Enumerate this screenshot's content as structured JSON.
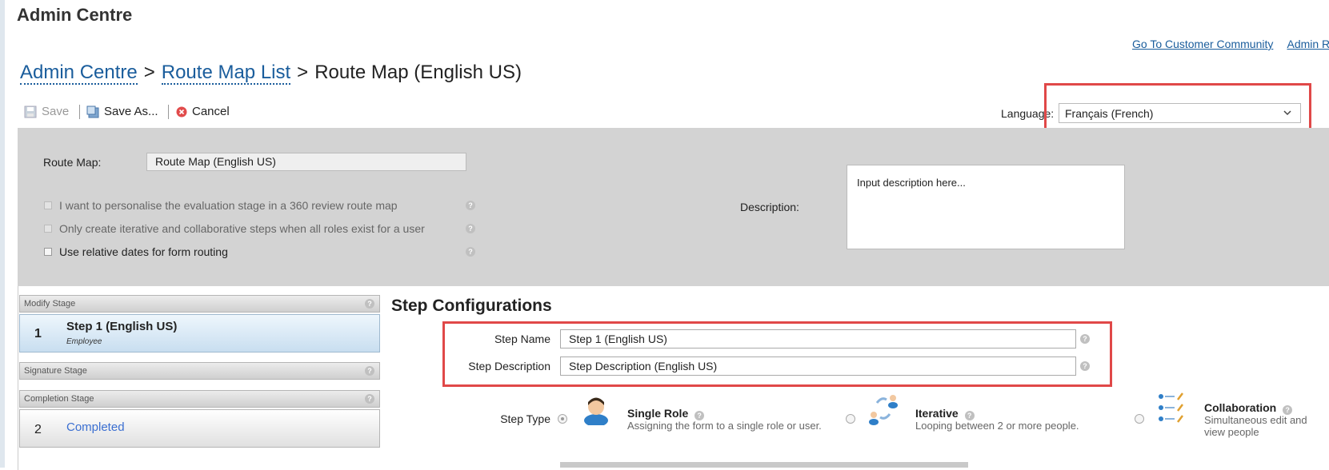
{
  "app": {
    "title": "Admin Centre"
  },
  "top_links": [
    "Go To Customer Community",
    "Admin R"
  ],
  "breadcrumb": {
    "item1": "Admin Centre",
    "item2": "Route Map List",
    "sep": ">",
    "current": "Route Map (English US)"
  },
  "toolbar": {
    "save": "Save",
    "save_as": "Save As...",
    "cancel": "Cancel",
    "language_label": "Language:",
    "language_value": "Français (French)"
  },
  "form": {
    "route_map_label": "Route Map:",
    "route_map_value": "Route Map (English US)",
    "options": [
      {
        "label": "I want to personalise the evaluation stage in a 360 review route map",
        "enabled": false
      },
      {
        "label": "Only create iterative and collaborative steps when all roles exist for a user",
        "enabled": false
      },
      {
        "label": "Use relative dates for form routing",
        "enabled": true
      }
    ],
    "description_label": "Description:",
    "description_placeholder": "Input description here..."
  },
  "stages": {
    "modify_header": "Modify Stage",
    "step1_num": "1",
    "step1_name": "Step 1 (English US)",
    "step1_role": "Employee",
    "signature_header": "Signature Stage",
    "completion_header": "Completion Stage",
    "step2_num": "2",
    "step2_name": "Completed"
  },
  "step_config": {
    "title": "Step Configurations",
    "step_name_label": "Step Name",
    "step_name_value": "Step 1 (English US)",
    "step_desc_label": "Step Description",
    "step_desc_value": "Step Description (English US)",
    "step_type_label": "Step Type",
    "types": [
      {
        "title": "Single Role",
        "desc": "Assigning the form to a single role or user.",
        "selected": true
      },
      {
        "title": "Iterative",
        "desc": "Looping between 2 or more people.",
        "selected": false
      },
      {
        "title": "Collaboration",
        "desc": "Simultaneous edit and view people",
        "selected": false
      }
    ]
  },
  "colors": {
    "link": "#1a5d9c",
    "highlight": "#e04848",
    "panel_gray": "#d3d3d3"
  }
}
